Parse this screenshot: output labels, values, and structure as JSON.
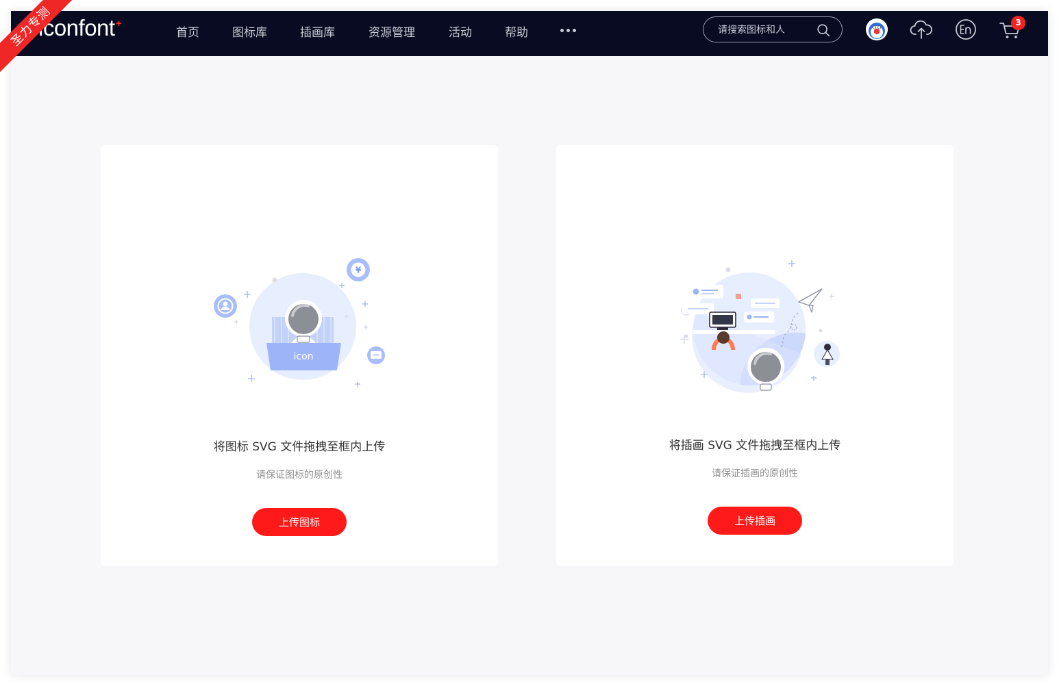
{
  "ribbon": {
    "text": "圣力专测"
  },
  "nav": {
    "logo": "iconfont",
    "logo_plus": "+",
    "items": [
      "首页",
      "图标库",
      "插画库",
      "资源管理",
      "活动",
      "帮助"
    ],
    "search_placeholder": "请搜索图标和人",
    "cart_count": "3",
    "icons": [
      "search-icon",
      "avatar-icon",
      "upload-cloud-icon",
      "language-en-icon",
      "cart-icon",
      "more-icon"
    ]
  },
  "cards": [
    {
      "illustration_label": "icon",
      "title": "将图标 SVG 文件拖拽至框内上传",
      "subtitle": "请保证图标的原创性",
      "button": "上传图标"
    },
    {
      "title": "将插画 SVG 文件拖拽至框内上传",
      "subtitle": "请保证插画的原创性",
      "button": "上传插画"
    }
  ],
  "colors": {
    "navbar": "#080b22",
    "accent": "#ff1a1a",
    "illustration_blue": "#8fa9f7",
    "page_background": "#f7f7f9"
  }
}
